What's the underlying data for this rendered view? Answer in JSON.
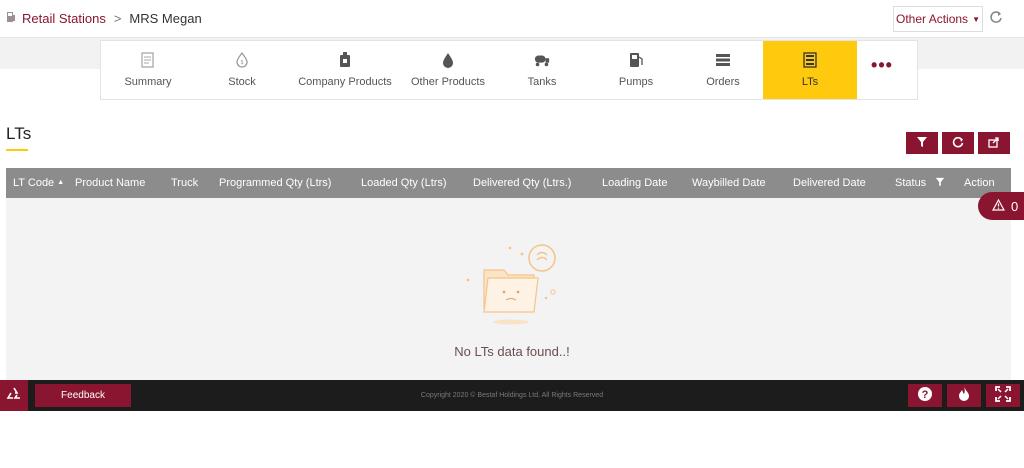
{
  "breadcrumb": {
    "root": "Retail Stations",
    "separator": ">",
    "current": "MRS Megan"
  },
  "header": {
    "other_actions": "Other Actions"
  },
  "tabs": [
    {
      "label": "Summary",
      "icon": "summary-icon"
    },
    {
      "label": "Stock",
      "icon": "stock-icon"
    },
    {
      "label": "Company Products",
      "icon": "company-products-icon"
    },
    {
      "label": "Other Products",
      "icon": "drop-icon"
    },
    {
      "label": "Tanks",
      "icon": "tank-icon"
    },
    {
      "label": "Pumps",
      "icon": "pump-icon"
    },
    {
      "label": "Orders",
      "icon": "orders-icon"
    },
    {
      "label": "LTs",
      "icon": "lts-icon",
      "active": true
    }
  ],
  "more_tabs": "•••",
  "section": {
    "title": "LTs"
  },
  "table": {
    "columns": [
      "LT Code",
      "Product Name",
      "Truck",
      "Programmed Qty (Ltrs)",
      "Loaded Qty (Ltrs)",
      "Delivered Qty (Ltrs.)",
      "Loading Date",
      "Waybilled Date",
      "Delivered Date",
      "Status",
      "Action"
    ],
    "empty_message": "No LTs data found..!"
  },
  "alert": {
    "count": "0"
  },
  "footer": {
    "feedback": "Feedback",
    "copyright": "Copyright 2020 © Bestaf Holdings Ltd. All Rights Reserved"
  },
  "colors": {
    "brand": "#8a1531",
    "accent": "#ffc90e",
    "header_grey": "#8c8c8c",
    "footer": "#1c1c1c"
  }
}
